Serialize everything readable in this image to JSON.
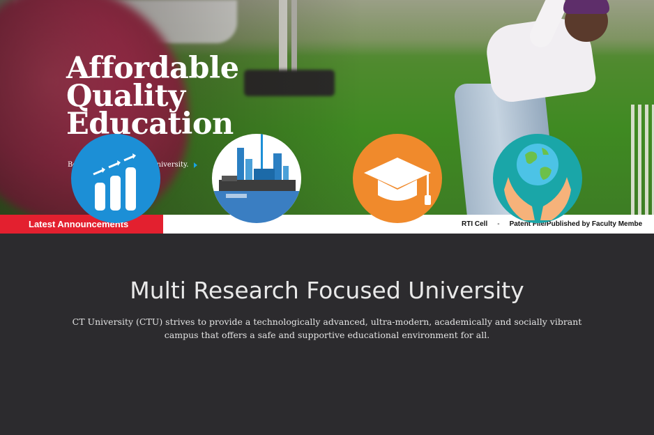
{
  "hero": {
    "title_lines": [
      "Affordable",
      "Quality",
      "Education"
    ],
    "cta_text": "Be a part of top ranked university."
  },
  "announcements": {
    "label": "Latest Announcements",
    "items": [
      "RTI Cell",
      "-",
      "Patent File/Published by Faculty Membe"
    ]
  },
  "main": {
    "title": "Multi Research Focused University",
    "description": "CT University (CTU) strives to provide a technologically advanced, ultra-modern, academically and socially vibrant campus that offers a safe and supportive educational environment for all."
  },
  "features": [
    {
      "icon": "growth-chart-icon",
      "color": "#1c8fd6"
    },
    {
      "icon": "industry-icon",
      "color": "#ffffff"
    },
    {
      "icon": "graduation-cap-icon",
      "color": "#f08a2c"
    },
    {
      "icon": "globe-hands-icon",
      "color": "#1aa6a8"
    }
  ],
  "colors": {
    "accent_red": "#e3202f",
    "background_dark": "#2c2b2e",
    "cta_arrow": "#1aa3e0"
  }
}
